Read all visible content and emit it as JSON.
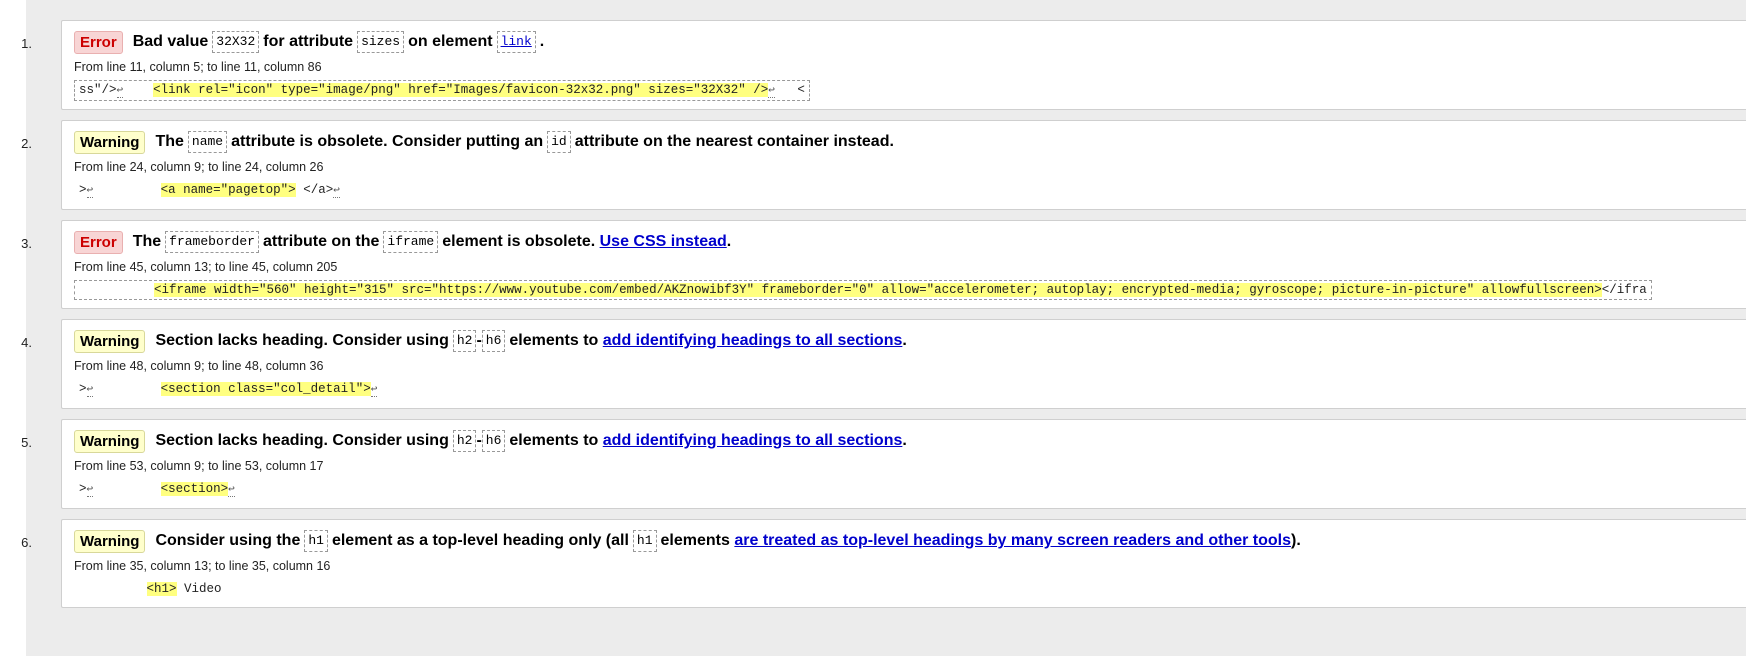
{
  "messages": [
    {
      "num": "1.",
      "type": "Error",
      "location": "From line 11, column 5; to line 11, column 86",
      "extract": {
        "before": "ss\"/>",
        "highlight": "<link rel=\"icon\" type=\"image/png\" href=\"Images/favicon-32x32.png\" sizes=\"32X32\" />",
        "after": "<",
        "bordered": true
      },
      "text": {
        "a": "Bad value",
        "code1": "32X32",
        "b": "for attribute",
        "code2": "sizes",
        "c": "on element",
        "code3": "link",
        "d": "."
      }
    },
    {
      "num": "2.",
      "type": "Warning",
      "location": "From line 24, column 9; to line 24, column 26",
      "extract": {
        "before": ">",
        "highlight": "<a name=\"pagetop\">",
        "after": " </a>",
        "bordered": false
      },
      "text": {
        "a": "The",
        "code1": "name",
        "b": "attribute is obsolete. Consider putting an",
        "code2": "id",
        "c": "attribute on the nearest container instead."
      }
    },
    {
      "num": "3.",
      "type": "Error",
      "location": "From line 45, column 13; to line 45, column 205",
      "extract": {
        "before": "",
        "highlight": "<iframe width=\"560\" height=\"315\" src=\"https://www.youtube.com/embed/AKZnowibf3Y\" frameborder=\"0\" allow=\"accelerometer; autoplay; encrypted-media; gyroscope; picture-in-picture\" allowfullscreen>",
        "after": "</ifra",
        "bordered": true
      },
      "text": {
        "a": "The",
        "code1": "frameborder",
        "b": "attribute on the",
        "code2": "iframe",
        "c": "element is obsolete.",
        "link": "Use CSS instead",
        "d": "."
      }
    },
    {
      "num": "4.",
      "type": "Warning",
      "location": "From line 48, column 9; to line 48, column 36",
      "extract": {
        "before": ">",
        "highlight": "<section class=\"col_detail\">",
        "after": "",
        "bordered": false
      },
      "text": {
        "a": "Section lacks heading. Consider using",
        "code1": "h2",
        "dash": "-",
        "code2": "h6",
        "b": "elements to",
        "link": "add identifying headings to all sections",
        "d": "."
      }
    },
    {
      "num": "5.",
      "type": "Warning",
      "location": "From line 53, column 9; to line 53, column 17",
      "extract": {
        "before": ">",
        "highlight": "<section>",
        "after": "",
        "bordered": false
      },
      "text": {
        "a": "Section lacks heading. Consider using",
        "code1": "h2",
        "dash": "-",
        "code2": "h6",
        "b": "elements to",
        "link": "add identifying headings to all sections",
        "d": "."
      }
    },
    {
      "num": "6.",
      "type": "Warning",
      "location": "From line 35, column 13; to line 35, column 16",
      "extract": {
        "before": "",
        "highlight": "<h1>",
        "after": " Video",
        "bordered": false
      },
      "text": {
        "a": "Consider using the",
        "code1": "h1",
        "b": "element as a top-level heading only (all",
        "code2": "h1",
        "c": "elements",
        "link": "are treated as top-level headings by many screen readers and other tools",
        "d": ")."
      }
    }
  ],
  "colors": {
    "error_bg": "#f8d5d5",
    "warning_bg": "#ffffcc",
    "highlight": "#ffff80",
    "link": "#0000cc"
  },
  "icons": {
    "return": "return-symbol"
  }
}
